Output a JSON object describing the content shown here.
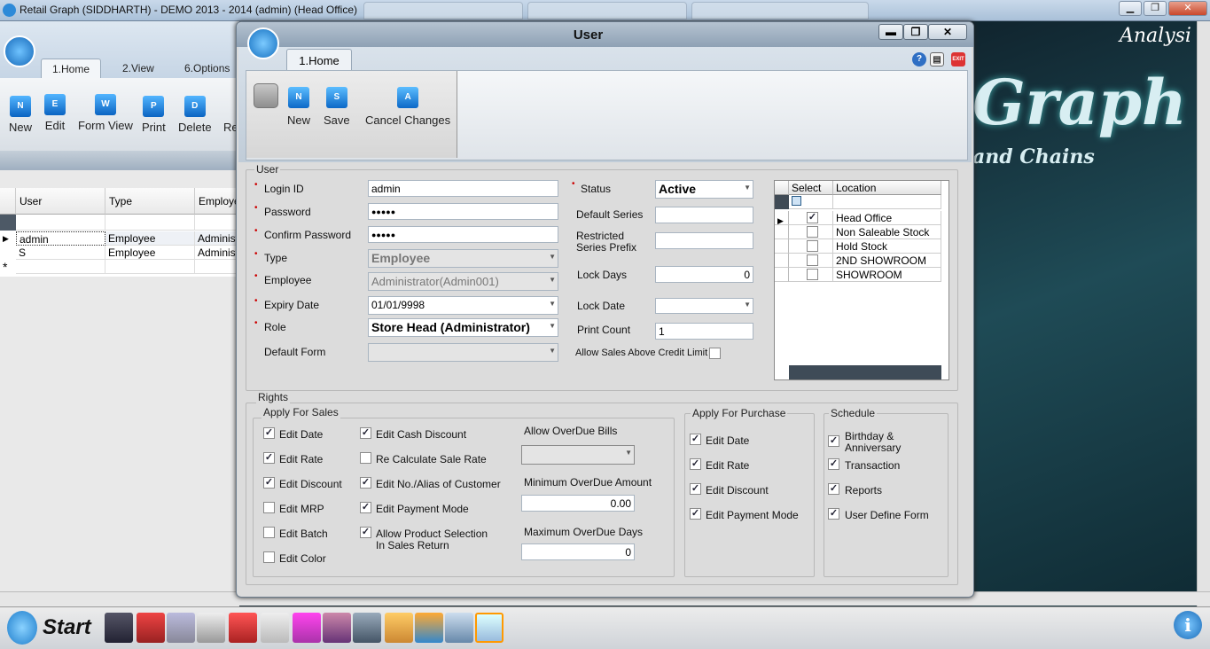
{
  "window": {
    "title": "Retail Graph (SIDDHARTH) - DEMO  2013 - 2014 (admin) (Head Office)",
    "controls": [
      "▁",
      "❐",
      "✕"
    ]
  },
  "bg_app": {
    "tabs": [
      "1.Home",
      "2.View",
      "6.Options"
    ],
    "toolbar": {
      "new": "New",
      "edit": "Edit",
      "form_view": "Form View",
      "print": "Print",
      "delete": "Delete",
      "re": "Re"
    },
    "toolbar_icons": {
      "new": "N",
      "edit": "E",
      "form_view": "W",
      "print": "P",
      "delete": "D"
    },
    "grid": {
      "headers": [
        "User",
        "Type",
        "Employe"
      ],
      "rows": [
        {
          "user": "admin",
          "type": "Employee",
          "emp": "Administ"
        },
        {
          "user": "S",
          "type": "Employee",
          "emp": "Administ"
        }
      ],
      "new_row_marker": "*"
    },
    "brand_big": "Graph",
    "brand_sub": "and Chains",
    "brand_top": "Analysi"
  },
  "dialog": {
    "title": "User",
    "controls": [
      "▬",
      "❐",
      "✕"
    ],
    "tab": "1.Home",
    "buttons": {
      "new": "New",
      "save": "Save",
      "cancel": "Cancel Changes"
    },
    "button_icons": {
      "new": "N",
      "save": "S",
      "cancel": "A"
    },
    "help_icons": [
      "?",
      "▤",
      "EXIT"
    ],
    "user_group": "User",
    "fields": {
      "login_id_label": "Login ID",
      "login_id": "admin",
      "password_label": "Password",
      "password": "●●●●●",
      "confirm_label": "Confirm Password",
      "confirm": "●●●●●",
      "type_label": "Type",
      "type": "Employee",
      "employee_label": "Employee",
      "employee": "Administrator(Admin001)",
      "expiry_label": "Expiry Date",
      "expiry": "01/01/9998",
      "role_label": "Role",
      "role": "Store Head (Administrator)",
      "default_form_label": "Default Form",
      "default_form": "",
      "status_label": "Status",
      "status": "Active",
      "default_series_label": "Default Series",
      "default_series": "",
      "restricted_label_1": "Restricted",
      "restricted_label_2": "Series Prefix",
      "restricted": "",
      "lock_days_label": "Lock Days",
      "lock_days": "0",
      "lock_date_label": "Lock Date",
      "lock_date": "",
      "print_count_label": "Print Count",
      "print_count": "1",
      "allow_sales_label": "Allow Sales Above Credit Limit"
    },
    "locations": {
      "headers": [
        "Select",
        "Location"
      ],
      "rows": [
        {
          "name": "Head Office",
          "checked": true
        },
        {
          "name": "Non Saleable Stock",
          "checked": false
        },
        {
          "name": "Hold Stock",
          "checked": false
        },
        {
          "name": "2ND SHOWROOM",
          "checked": false
        },
        {
          "name": "SHOWROOM",
          "checked": false
        }
      ]
    },
    "rights": {
      "title": "Rights",
      "sales_title": "Apply For Sales",
      "sales_col1": [
        {
          "label": "Edit Date",
          "checked": true
        },
        {
          "label": "Edit Rate",
          "checked": true
        },
        {
          "label": "Edit Discount",
          "checked": true
        },
        {
          "label": "Edit MRP",
          "checked": false
        },
        {
          "label": "Edit Batch",
          "checked": false
        },
        {
          "label": "Edit Color",
          "checked": false
        }
      ],
      "sales_col2": [
        {
          "label": "Edit Cash Discount",
          "checked": true
        },
        {
          "label": "Re Calculate Sale Rate",
          "checked": false
        },
        {
          "label": "Edit No./Alias of Customer",
          "checked": true
        },
        {
          "label": "Edit Payment Mode",
          "checked": true
        },
        {
          "label": "Allow Product Selection",
          "label2": "In Sales Return",
          "checked": true
        }
      ],
      "overdue_bills_label": "Allow OverDue Bills",
      "min_overdue_label": "Minimum OverDue Amount",
      "min_overdue": "0.00",
      "max_overdue_label": "Maximum OverDue Days",
      "max_overdue": "0",
      "purchase_title": "Apply For Purchase",
      "purchase": [
        {
          "label": "Edit Date",
          "checked": true
        },
        {
          "label": "Edit Rate",
          "checked": true
        },
        {
          "label": "Edit Discount",
          "checked": true
        },
        {
          "label": "Edit Payment Mode",
          "checked": true
        }
      ],
      "schedule_title": "Schedule",
      "schedule": [
        {
          "label": "Birthday &",
          "label2": "Anniversary",
          "checked": true
        },
        {
          "label": "Transaction",
          "checked": true
        },
        {
          "label": "Reports",
          "checked": true
        },
        {
          "label": "User Define Form",
          "checked": true
        }
      ]
    }
  },
  "taskbar": {
    "start": "Start",
    "info_icon": "i"
  }
}
